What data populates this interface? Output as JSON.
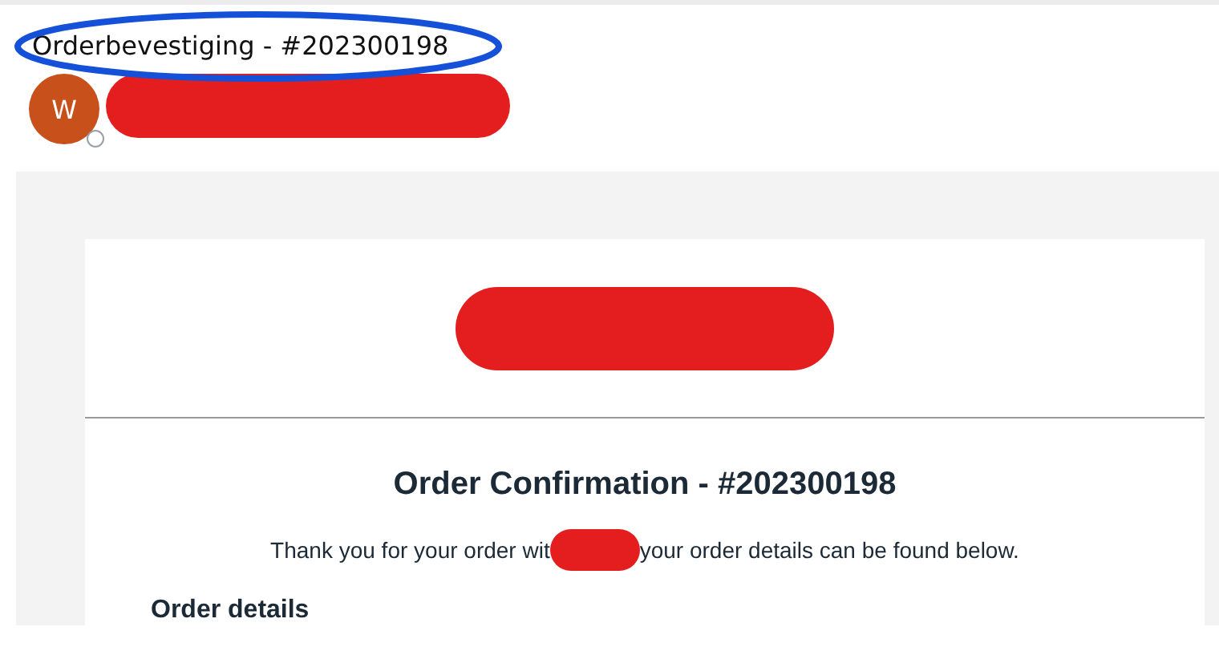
{
  "subject": {
    "text": "Orderbevestiging - #202300198",
    "circled": true
  },
  "sender": {
    "initial": "W",
    "online": false,
    "name_redacted": true
  },
  "email": {
    "logo_redacted": true,
    "heading": "Order Confirmation - #202300198",
    "intro": [
      {
        "kind": "text",
        "text": "Thank you for your order wit"
      },
      {
        "kind": "redaction"
      },
      {
        "kind": "text",
        "text": "your order details can be found below."
      }
    ],
    "section_title": "Order details"
  }
}
